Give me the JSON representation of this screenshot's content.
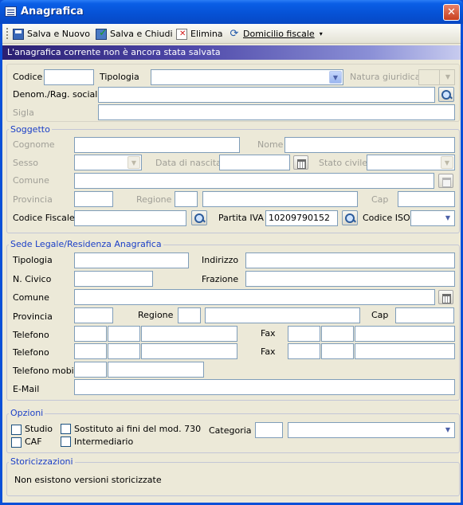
{
  "window": {
    "title": "Anagrafica",
    "close_glyph": "✕"
  },
  "toolbar": {
    "save_new": "Salva e Nuovo",
    "save_close": "Salva e Chiudi",
    "delete": "Elimina",
    "domicilio": "Domicilio fiscale",
    "caret": "▾"
  },
  "banner": "L'anagrafica corrente non è ancora stata salvata",
  "top": {
    "codice": "Codice",
    "tipologia": "Tipologia",
    "natura": "Natura giuridica",
    "denom": "Denom./Rag. sociale",
    "sigla": "Sigla"
  },
  "soggetto": {
    "legend": "Soggetto",
    "cognome": "Cognome",
    "nome": "Nome",
    "sesso": "Sesso",
    "data_nascita": "Data di nascita",
    "stato_civile": "Stato civile",
    "comune": "Comune",
    "provincia": "Provincia",
    "regione": "Regione",
    "cap": "Cap",
    "codice_fiscale": "Codice Fiscale",
    "partita_iva": "Partita IVA",
    "partita_iva_value": "10209790152",
    "codice_iso": "Codice ISO"
  },
  "sede": {
    "legend": "Sede Legale/Residenza Anagrafica",
    "tipologia": "Tipologia",
    "indirizzo": "Indirizzo",
    "civico": "N. Civico",
    "frazione": "Frazione",
    "comune": "Comune",
    "provincia": "Provincia",
    "regione": "Regione",
    "cap": "Cap",
    "telefono": "Telefono",
    "fax": "Fax",
    "telefono_mobile": "Telefono mobile",
    "email": "E-Mail"
  },
  "opzioni": {
    "legend": "Opzioni",
    "studio": "Studio",
    "sostituto": "Sostituto ai fini del mod. 730",
    "caf": "CAF",
    "intermediario": "Intermediario",
    "categoria": "Categoria"
  },
  "storicizzazioni": {
    "legend": "Storicizzazioni",
    "text": "Non esistono versioni storicizzate"
  },
  "icons": {
    "combo": "▼"
  }
}
